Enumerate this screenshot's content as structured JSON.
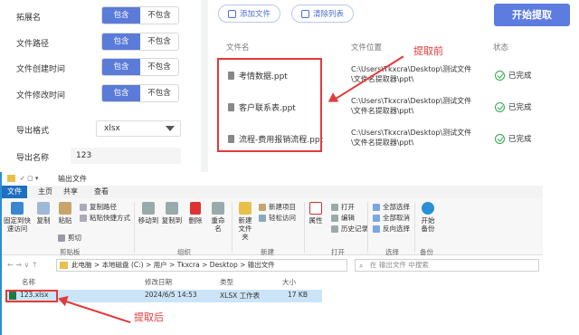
{
  "settings": {
    "rows": [
      {
        "label": "拓展名",
        "on": "包含",
        "off": "不包含"
      },
      {
        "label": "文件路径",
        "on": "包含",
        "off": "不包含"
      },
      {
        "label": "文件创建时间",
        "on": "包含",
        "off": "不包含"
      },
      {
        "label": "文件修改时间",
        "on": "包含",
        "off": "不包含"
      }
    ],
    "export_format_label": "导出格式",
    "export_format_value": "xlsx",
    "export_name_label": "导出名称",
    "export_name_value": "123"
  },
  "toolbar": {
    "add_file": "添加文件",
    "clear_list": "清除列表",
    "start": "开始提取"
  },
  "table": {
    "headers": {
      "name": "文件名",
      "location": "文件位置",
      "status": "状态"
    },
    "rows": [
      {
        "name": "考情数据.ppt",
        "location": "C:\\Users\\Tkxcra\\Desktop\\测试文件\\文件名提取器\\ppt\\",
        "status": "已完成"
      },
      {
        "name": "客户联系表.ppt",
        "location": "C:\\Users\\Tkxcra\\Desktop\\测试文件\\文件名提取器\\ppt\\",
        "status": "已完成"
      },
      {
        "name": "流程-费用报销流程.ppt",
        "location": "C:\\Users\\Tkxcra\\Desktop\\测试文件\\文件名提取器\\ppt\\",
        "status": "已完成"
      }
    ]
  },
  "annotations": {
    "before": "提取前",
    "after": "提取后"
  },
  "explorer": {
    "title": "输出文件",
    "tabs": [
      "文件",
      "主页",
      "共享",
      "查看"
    ],
    "ribbon": {
      "pin": "固定到快速访问",
      "copy": "复制",
      "paste": "粘贴",
      "copy_path": "复制路径",
      "paste_shortcut": "粘贴快捷方式",
      "cut": "剪切",
      "clipboard_group": "剪贴板",
      "move_to": "移动到",
      "copy_to": "复制到",
      "delete": "删除",
      "rename": "重命名",
      "organize_group": "组织",
      "new_folder": "新建文件夹",
      "new_item": "新建项目",
      "easy_access": "轻松访问",
      "new_group": "新建",
      "properties": "属性",
      "open": "打开",
      "edit": "编辑",
      "history": "历史记录",
      "open_group": "打开",
      "select_all": "全部选择",
      "select_none": "全部取消",
      "invert": "反向选择",
      "select_group": "选择",
      "backup": "开始备份",
      "backup_group": "备份"
    },
    "address": [
      "此电脑",
      "本地磁盘 (C:)",
      "用户",
      "Tkxcra",
      "Desktop",
      "输出文件"
    ],
    "search_placeholder": "在 输出文件 中搜索",
    "columns": {
      "name": "名称",
      "date": "修改日期",
      "type": "类型",
      "size": "大小"
    },
    "files": [
      {
        "name": "123.xlsx",
        "date": "2024/6/5 14:53",
        "type": "XLSX 工作表",
        "size": "17 KB"
      }
    ]
  },
  "colors": {
    "accent": "#5b7bd8",
    "annotation": "#e23a3a",
    "done": "#2eaa4a"
  }
}
